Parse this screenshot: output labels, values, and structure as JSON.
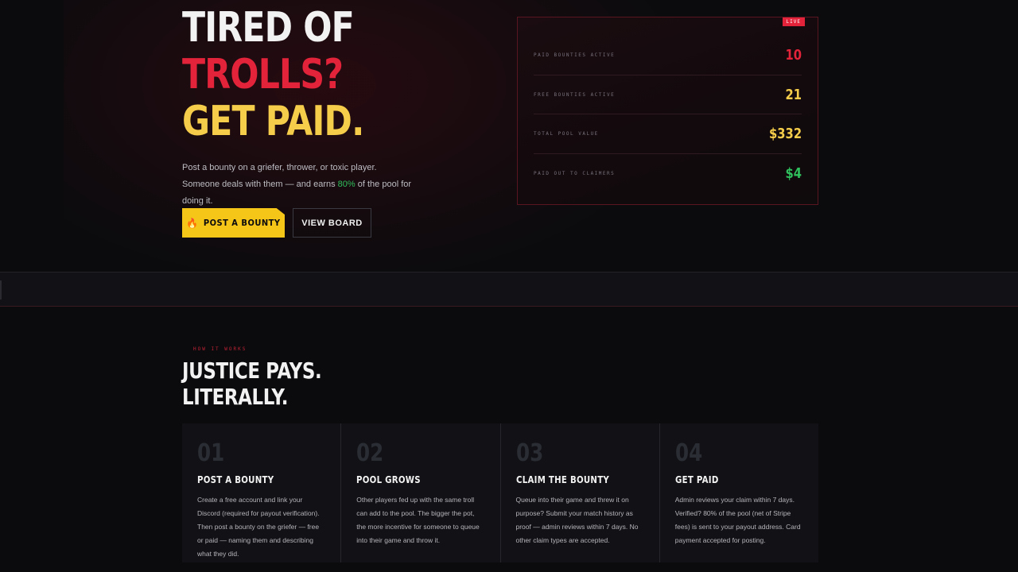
{
  "hero": {
    "line1": "TIRED OF",
    "line2": "TROLLS?",
    "line3": "GET PAID.",
    "desc_before": "Post a bounty on a griefer, thrower, or toxic player. Someone deals with them — and earns ",
    "desc_percent": "80%",
    "desc_after": " of the pool for doing it.",
    "primary_button": "POST A BOUNTY",
    "primary_icon": "flame-icon",
    "secondary_button": "VIEW BOARD"
  },
  "stats": {
    "badge": "LIVE",
    "rows": [
      {
        "label": "PAID BOUNTIES ACTIVE",
        "value": "10",
        "color": "#e3233a"
      },
      {
        "label": "FREE BOUNTIES ACTIVE",
        "value": "21",
        "color": "#f6cd4a"
      },
      {
        "label": "TOTAL POOL VALUE",
        "value": "$332",
        "color": "#f6cd4a"
      },
      {
        "label": "PAID OUT TO CLAIMERS",
        "value": "$4",
        "color": "#2fbf5c"
      }
    ]
  },
  "how": {
    "kicker": "HOW IT WORKS",
    "title_line1": "JUSTICE PAYS.",
    "title_line2": "LITERALLY.",
    "steps": [
      {
        "num": "01",
        "title": "POST A BOUNTY",
        "desc": "Create a free account and link your Discord (required for payout verification). Then post a bounty on the griefer — free or paid — naming them and describing what they did."
      },
      {
        "num": "02",
        "title": "POOL GROWS",
        "desc": "Other players fed up with the same troll can add to the pool. The bigger the pot, the more incentive for someone to queue into their game and throw it."
      },
      {
        "num": "03",
        "title": "CLAIM THE BOUNTY",
        "desc": "Queue into their game and threw it on purpose? Submit your match history as proof — admin reviews within 7 days. No other claim types are accepted."
      },
      {
        "num": "04",
        "title": "GET PAID",
        "desc": "Admin reviews your claim within 7 days. Verified? 80% of the pool (net of Stripe fees) is sent to your payout address. Card payment accepted for posting."
      }
    ]
  },
  "colors": {
    "accent_red": "#e3233a",
    "accent_yellow": "#f5c518",
    "accent_green": "#2fbf5c",
    "background": "#0b0b0e"
  }
}
